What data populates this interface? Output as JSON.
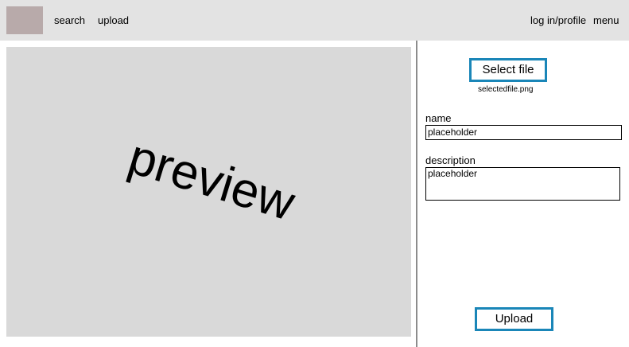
{
  "header": {
    "nav": {
      "search": "search",
      "upload": "upload",
      "login": "log in/profile",
      "menu": "menu"
    },
    "colors": {
      "bar": "#e3e3e3",
      "logo": "#b8aaaa"
    }
  },
  "preview": {
    "label": "preview",
    "background": "#d9d9d9"
  },
  "form": {
    "select_file_label": "Select file",
    "selected_filename": "selectedfile.png",
    "name_label": "name",
    "name_placeholder": "placeholder",
    "description_label": "description",
    "description_placeholder": "placeholder",
    "upload_label": "Upload",
    "accent": "#1a86b8"
  }
}
